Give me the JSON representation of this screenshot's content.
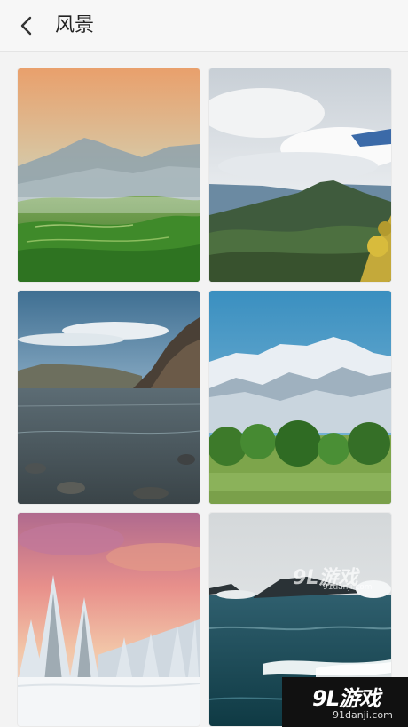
{
  "header": {
    "title": "风景",
    "back_icon": "chevron-left-icon"
  },
  "gallery": {
    "images": [
      {
        "subject": "misty-mountain-tea-hills"
      },
      {
        "subject": "cloudy-mountain-ridge"
      },
      {
        "subject": "rocky-coast-lake"
      },
      {
        "subject": "snow-capped-mountains-forest"
      },
      {
        "subject": "snowy-pine-forest-sunset"
      },
      {
        "subject": "stormy-sea-rocks"
      }
    ]
  },
  "watermark": {
    "logo": "9L游戏",
    "url": "91danji.com"
  }
}
